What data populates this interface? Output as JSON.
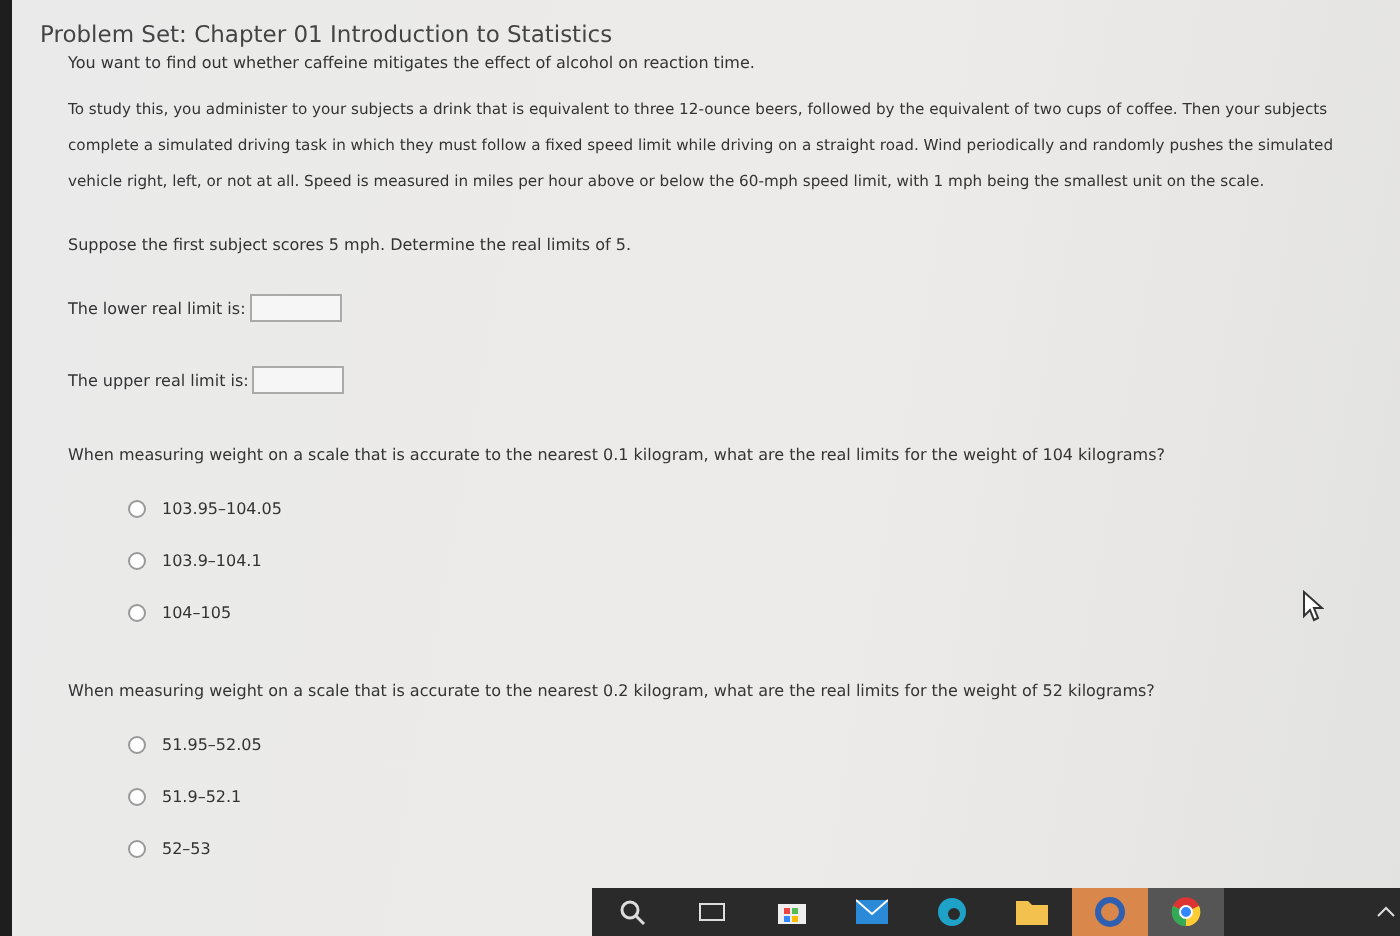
{
  "title": "Problem Set: Chapter 01 Introduction to Statistics",
  "intro": "You want to find out whether caffeine mitigates the effect of alcohol on reaction time.",
  "scenario": "To study this, you administer to your subjects a drink that is equivalent to three 12-ounce beers, followed by the equivalent of two cups of coffee. Then your subjects complete a simulated driving task in which they must follow a fixed speed limit while driving on a straight road. Wind periodically and randomly pushes the simulated vehicle right, left, or not at all. Speed is measured in miles per hour above or below the 60-mph speed limit, with 1 mph being the smallest unit on the scale.",
  "questions": [
    {
      "kind": "fields",
      "prompt": "Suppose the first subject scores 5 mph. Determine the real limits of 5.",
      "fields": [
        {
          "label": "The lower real limit is:"
        },
        {
          "label": "The upper real limit is:"
        }
      ]
    },
    {
      "kind": "choice",
      "prompt": "When measuring weight on a scale that is accurate to the nearest 0.1 kilogram, what are the real limits for the weight of 104 kilograms?",
      "options": [
        {
          "label": "103.95–104.05",
          "selected": false
        },
        {
          "label": "103.9–104.1",
          "selected": false
        },
        {
          "label": "104–105",
          "selected": false
        }
      ]
    },
    {
      "kind": "choice",
      "prompt": "When measuring weight on a scale that is accurate to the nearest 0.2 kilogram, what are the real limits for the weight of 52 kilograms?",
      "options": [
        {
          "label": "51.95–52.05",
          "selected": false
        },
        {
          "label": "51.9–52.1",
          "selected": false
        },
        {
          "label": "52–53",
          "selected": false
        }
      ]
    }
  ]
}
